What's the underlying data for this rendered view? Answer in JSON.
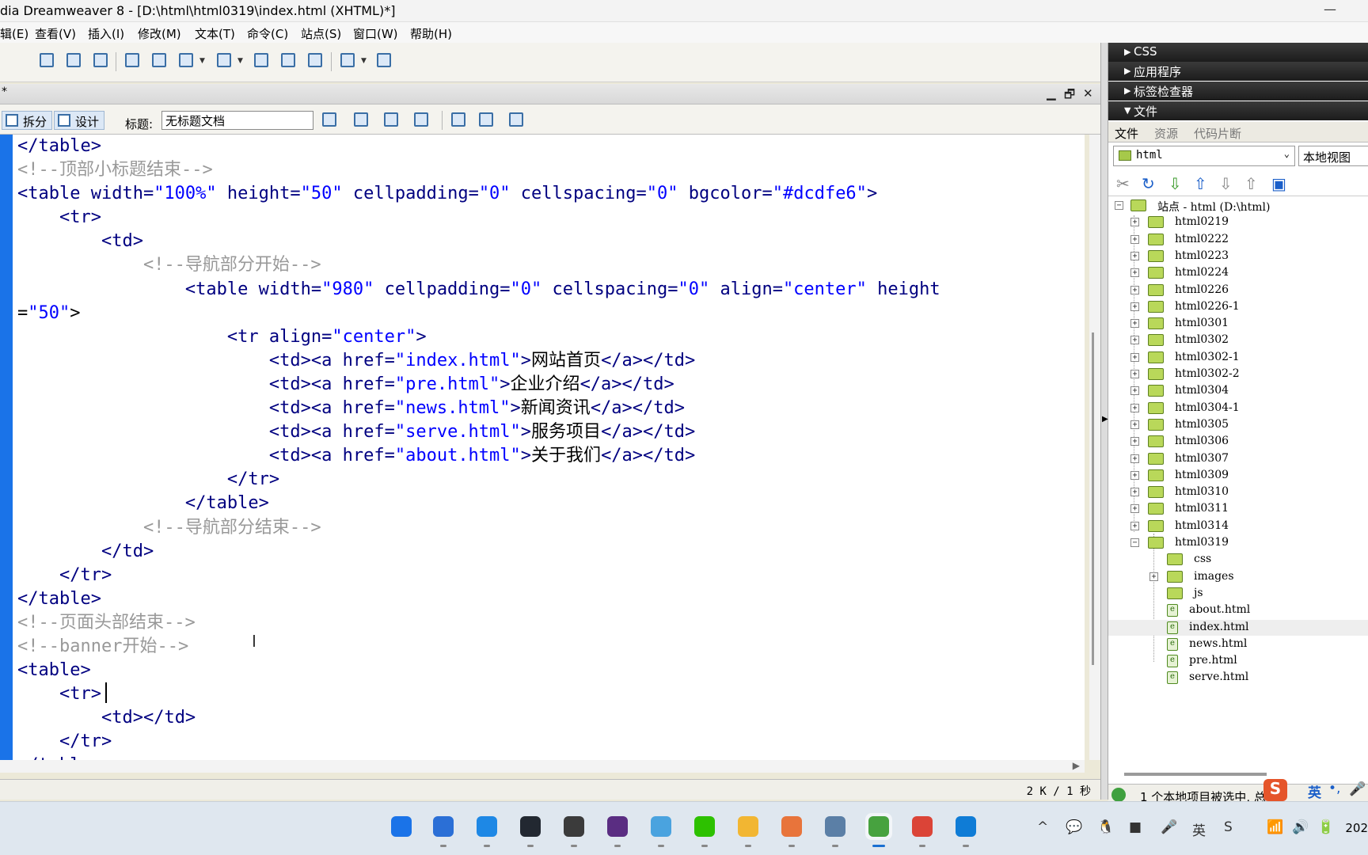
{
  "window": {
    "title": "dia Dreamweaver 8 - [D:\\html\\html0319\\index.html (XHTML)*]",
    "minimize_glyph": "—"
  },
  "menu": [
    "辑(E)",
    "查看(V)",
    "插入(I)",
    "修改(M)",
    "文本(T)",
    "命令(C)",
    "站点(S)",
    "窗口(W)",
    "帮助(H)"
  ],
  "document": {
    "tab_marker": "*",
    "controls": {
      "minimize": "▁",
      "restore": "🗗",
      "close": "✕"
    },
    "views": {
      "split": "拆分",
      "design": "设计"
    },
    "title_label": "标题:",
    "title_value": "无标题文档"
  },
  "code_lines": [
    "</table>",
    "<!--顶部小标题结束-->",
    "<table width=\"100%\" height=\"50\" cellpadding=\"0\" cellspacing=\"0\" bgcolor=\"#dcdfe6\">",
    "    <tr>",
    "        <td>",
    "            <!--导航部分开始-->",
    "                <table width=\"980\" cellpadding=\"0\" cellspacing=\"0\" align=\"center\" height",
    "=\"50\">",
    "                    <tr align=\"center\">",
    "                        <td><a href=\"index.html\">网站首页</a></td>",
    "                        <td><a href=\"pre.html\">企业介绍</a></td>",
    "                        <td><a href=\"news.html\">新闻资讯</a></td>",
    "                        <td><a href=\"serve.html\">服务项目</a></td>",
    "                        <td><a href=\"about.html\">关于我们</a></td>",
    "                    </tr>",
    "                </table>",
    "            <!--导航部分结束-->",
    "        </td>",
    "    </tr>",
    "</table>",
    "<!--页面头部结束-->",
    "<!--banner开始-->",
    "<table>",
    "    <tr>",
    "        <td></td>",
    "    </tr>",
    "</tabl"
  ],
  "status": {
    "size": "2 K / 1 秒"
  },
  "panel": {
    "groups": [
      "CSS",
      "应用程序",
      "标签检查器",
      "文件"
    ],
    "tabs": [
      "文件",
      "资源",
      "代码片断"
    ],
    "site": "html",
    "view": "本地视图",
    "tree": [
      {
        "label": "站点 - html (D:\\html)",
        "level": 0,
        "type": "site",
        "exp": "−"
      },
      {
        "label": "html0219",
        "level": 1,
        "type": "folder",
        "exp": "+"
      },
      {
        "label": "html0222",
        "level": 1,
        "type": "folder",
        "exp": "+"
      },
      {
        "label": "html0223",
        "level": 1,
        "type": "folder",
        "exp": "+"
      },
      {
        "label": "html0224",
        "level": 1,
        "type": "folder",
        "exp": "+"
      },
      {
        "label": "html0226",
        "level": 1,
        "type": "folder",
        "exp": "+"
      },
      {
        "label": "html0226-1",
        "level": 1,
        "type": "folder",
        "exp": "+"
      },
      {
        "label": "html0301",
        "level": 1,
        "type": "folder",
        "exp": "+"
      },
      {
        "label": "html0302",
        "level": 1,
        "type": "folder",
        "exp": "+"
      },
      {
        "label": "html0302-1",
        "level": 1,
        "type": "folder",
        "exp": "+"
      },
      {
        "label": "html0302-2",
        "level": 1,
        "type": "folder",
        "exp": "+"
      },
      {
        "label": "html0304",
        "level": 1,
        "type": "folder",
        "exp": "+"
      },
      {
        "label": "html0304-1",
        "level": 1,
        "type": "folder",
        "exp": "+"
      },
      {
        "label": "html0305",
        "level": 1,
        "type": "folder",
        "exp": "+"
      },
      {
        "label": "html0306",
        "level": 1,
        "type": "folder",
        "exp": "+"
      },
      {
        "label": "html0307",
        "level": 1,
        "type": "folder",
        "exp": "+"
      },
      {
        "label": "html0309",
        "level": 1,
        "type": "folder",
        "exp": "+"
      },
      {
        "label": "html0310",
        "level": 1,
        "type": "folder",
        "exp": "+"
      },
      {
        "label": "html0311",
        "level": 1,
        "type": "folder",
        "exp": "+"
      },
      {
        "label": "html0314",
        "level": 1,
        "type": "folder",
        "exp": "+"
      },
      {
        "label": "html0319",
        "level": 1,
        "type": "folder",
        "exp": "−"
      },
      {
        "label": "css",
        "level": 2,
        "type": "folder",
        "exp": ""
      },
      {
        "label": "images",
        "level": 2,
        "type": "folder",
        "exp": "+"
      },
      {
        "label": "js",
        "level": 2,
        "type": "folder",
        "exp": ""
      },
      {
        "label": "about.html",
        "level": 2,
        "type": "file",
        "exp": ""
      },
      {
        "label": "index.html",
        "level": 2,
        "type": "file",
        "exp": "",
        "selected": true
      },
      {
        "label": "news.html",
        "level": 2,
        "type": "file",
        "exp": ""
      },
      {
        "label": "pre.html",
        "level": 2,
        "type": "file",
        "exp": ""
      },
      {
        "label": "serve.html",
        "level": 2,
        "type": "file",
        "exp": ""
      }
    ],
    "status": "1 个本地项目被选中, 总"
  },
  "ime": {
    "logo": "S",
    "mode": "英",
    "punct": "•,",
    "mic": "🎤"
  },
  "taskbar": {
    "apps": [
      {
        "name": "start",
        "color": "#1a73e8"
      },
      {
        "name": "copilot",
        "color": "#2b6fd6"
      },
      {
        "name": "edge-legacy",
        "color": "#1e88e5"
      },
      {
        "name": "terminal",
        "color": "#222831"
      },
      {
        "name": "sublime",
        "color": "#3b3b3b"
      },
      {
        "name": "phpstorm",
        "color": "#5a2d82"
      },
      {
        "name": "paint",
        "color": "#4aa3df"
      },
      {
        "name": "wechat",
        "color": "#2dc100"
      },
      {
        "name": "explorer",
        "color": "#f2b632"
      },
      {
        "name": "pdf",
        "color": "#e8743b"
      },
      {
        "name": "screenshot",
        "color": "#5b7fa6"
      },
      {
        "name": "dreamweaver",
        "color": "#47a23f"
      },
      {
        "name": "chrome",
        "color": "#db4437"
      },
      {
        "name": "edge",
        "color": "#0f7cd6"
      }
    ],
    "tray_icons": [
      "^",
      "💬",
      "🐧",
      "■",
      "🎤",
      "英",
      "S",
      "📶",
      "🔊",
      "🔋"
    ],
    "clock": "202"
  },
  "colors": {
    "accent": "#1a73e8",
    "tag": "#000080",
    "string": "#0000ff",
    "comment": "#999999",
    "panel_header": "#2a2a2a"
  }
}
